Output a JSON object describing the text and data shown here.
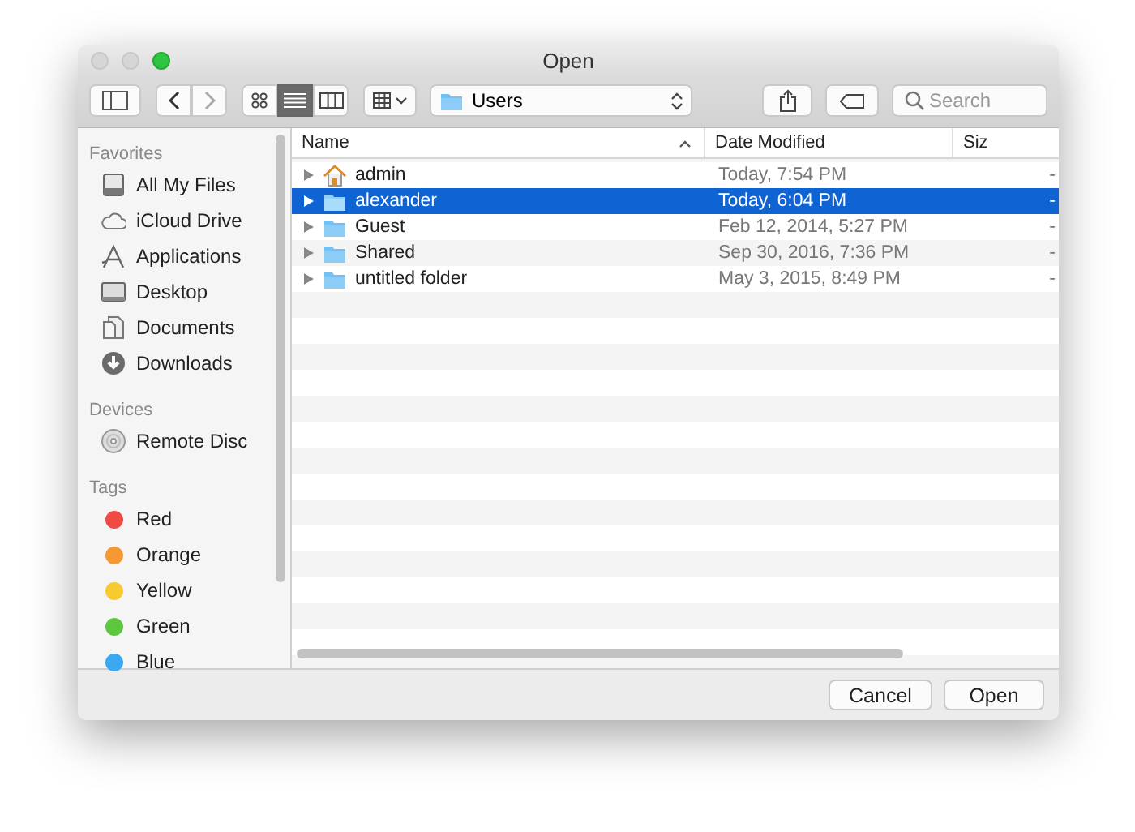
{
  "window": {
    "title": "Open"
  },
  "toolbar": {
    "view_modes": [
      {
        "kind": "icons",
        "selected": false
      },
      {
        "kind": "list",
        "selected": true
      },
      {
        "kind": "columns",
        "selected": false
      }
    ],
    "location": {
      "label": "Users"
    },
    "search": {
      "placeholder": "Search"
    }
  },
  "sidebar": {
    "sections": [
      {
        "heading": "Favorites",
        "items": [
          {
            "label": "All My Files",
            "kind": "drive"
          },
          {
            "label": "iCloud Drive",
            "kind": "cloud"
          },
          {
            "label": "Applications",
            "kind": "apps"
          },
          {
            "label": "Desktop",
            "kind": "desktop"
          },
          {
            "label": "Documents",
            "kind": "documents"
          },
          {
            "label": "Downloads",
            "kind": "downloads"
          }
        ]
      },
      {
        "heading": "Devices",
        "items": [
          {
            "label": "Remote Disc",
            "kind": "disc"
          }
        ]
      },
      {
        "heading": "Tags",
        "items": [
          {
            "label": "Red",
            "kind": "tag",
            "color": "#f04a45"
          },
          {
            "label": "Orange",
            "kind": "tag",
            "color": "#f59a32"
          },
          {
            "label": "Yellow",
            "kind": "tag",
            "color": "#f7cb2f"
          },
          {
            "label": "Green",
            "kind": "tag",
            "color": "#5fc73f"
          },
          {
            "label": "Blue",
            "kind": "tag",
            "color": "#3ba9f2"
          }
        ]
      }
    ]
  },
  "table": {
    "columns": [
      {
        "label": "Name",
        "sorted": true
      },
      {
        "label": "Date Modified",
        "sorted": false
      },
      {
        "label": "Siz",
        "sorted": false
      }
    ],
    "rows": [
      {
        "name": "admin",
        "kind": "home",
        "date": "Today, 7:54 PM",
        "size": "-",
        "selected": false
      },
      {
        "name": "alexander",
        "kind": "folder",
        "date": "Today, 6:04 PM",
        "size": "-",
        "selected": true
      },
      {
        "name": "Guest",
        "kind": "folder",
        "date": "Feb 12, 2014, 5:27 PM",
        "size": "-",
        "selected": false
      },
      {
        "name": "Shared",
        "kind": "folder",
        "date": "Sep 30, 2016, 7:36 PM",
        "size": "-",
        "selected": false
      },
      {
        "name": "untitled folder",
        "kind": "folder",
        "date": "May 3, 2015, 8:49 PM",
        "size": "-",
        "selected": false
      }
    ]
  },
  "buttons": [
    {
      "label": "Cancel"
    },
    {
      "label": "Open"
    }
  ]
}
